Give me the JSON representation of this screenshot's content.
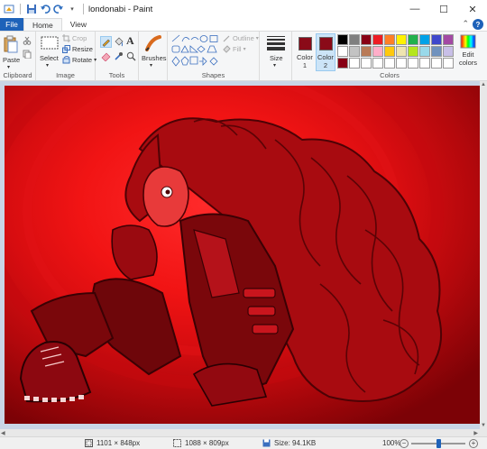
{
  "window": {
    "title": "londonabi - Paint"
  },
  "tabs": {
    "file": "File",
    "home": "Home",
    "view": "View"
  },
  "clipboard": {
    "paste": "Paste",
    "label": "Clipboard"
  },
  "image": {
    "select": "Select",
    "crop": "Crop",
    "resize": "Resize",
    "rotate": "Rotate",
    "label": "Image"
  },
  "tools": {
    "label": "Tools"
  },
  "brushes": {
    "label": "Brushes"
  },
  "shapes": {
    "outline": "Outline",
    "fill": "Fill",
    "label": "Shapes"
  },
  "size": {
    "label": "Size"
  },
  "colors": {
    "color1_label": "Color\n1",
    "color2_label": "Color\n2",
    "edit_label": "Edit\ncolors",
    "label": "Colors",
    "color1": "#8a0a18",
    "color2": "#8a0a18",
    "palette": [
      "#000000",
      "#7f7f7f",
      "#880015",
      "#ed1c24",
      "#ff7f27",
      "#fff200",
      "#22b14c",
      "#00a2e8",
      "#3f48cc",
      "#a349a4",
      "#ffffff",
      "#c3c3c3",
      "#b97a57",
      "#ffaec9",
      "#ffc90e",
      "#efe4b0",
      "#b5e61d",
      "#99d9ea",
      "#7092be",
      "#c8bfe7",
      "#880015",
      "#ffffff",
      "#ffffff",
      "#ffffff",
      "#ffffff",
      "#ffffff",
      "#ffffff",
      "#ffffff",
      "#ffffff",
      "#ffffff"
    ]
  },
  "status": {
    "image_size": "1101 × 848px",
    "selection_size": "1088 × 809px",
    "file_size": "Size: 94.1KB",
    "zoom": "100%",
    "zoom_fraction": 0.5
  },
  "icons": [
    "save-icon",
    "undo-icon",
    "redo-icon",
    "paste-icon",
    "cut-icon",
    "copy-icon",
    "select-icon",
    "crop-icon",
    "resize-icon",
    "rotate-icon",
    "pencil-icon",
    "fill-icon",
    "text-icon",
    "eraser-icon",
    "picker-icon",
    "magnifier-icon",
    "brush-icon",
    "shapes-icon",
    "size-icon",
    "palette-icon"
  ],
  "accent": "#1e62b9"
}
